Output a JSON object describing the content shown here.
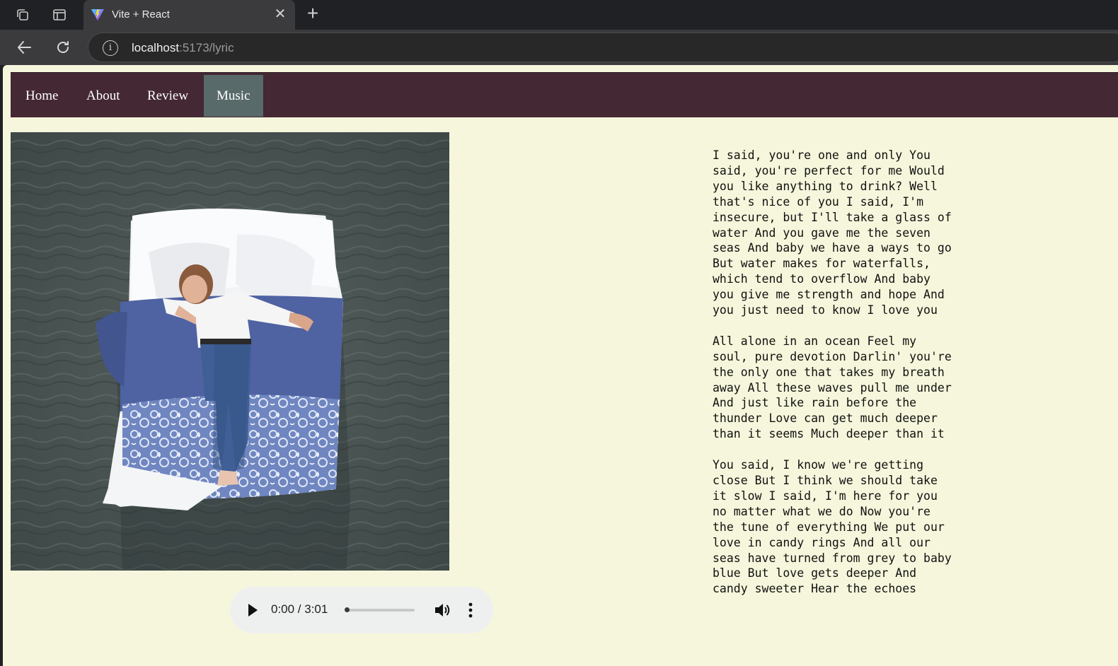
{
  "browser": {
    "tab": {
      "title": "Vite + React",
      "close_glyph": "✕",
      "favicon": "vite-logo"
    },
    "new_tab_glyph": "+",
    "url_host": "localhost",
    "url_rest": ":5173/lyric"
  },
  "nav": {
    "items": [
      {
        "label": "Home",
        "active": false
      },
      {
        "label": "About",
        "active": false
      },
      {
        "label": "Review",
        "active": false
      },
      {
        "label": "Music",
        "active": true
      }
    ]
  },
  "player": {
    "time": "0:00 / 3:01",
    "progress": 0.0
  },
  "lyrics": [
    "I said, you're one and only You said, you're perfect for me Would you like anything to drink? Well that's nice of you I said, I'm insecure, but I'll take a glass of water And you gave me the seven seas And baby we have a ways to go But water makes for waterfalls, which tend to overflow And baby you give me strength and hope And you just need to know I love you",
    "All alone in an ocean Feel my soul, pure devotion Darlin' you're the only one that takes my breath away All these waves pull me under And just like rain before the thunder Love can get much deeper than it seems Much deeper than it",
    "You said, I know we're getting close But I think we should take it slow I said, I'm here for you no matter what we do Now you're the tune of everything We put our love in candy rings And all our seas have turned from grey to baby blue But love gets deeper And candy sweeter Hear the echoes"
  ],
  "colors": {
    "page_background": "#f6f6dc",
    "navbar": "#442833",
    "nav_active": "#586a6a"
  }
}
